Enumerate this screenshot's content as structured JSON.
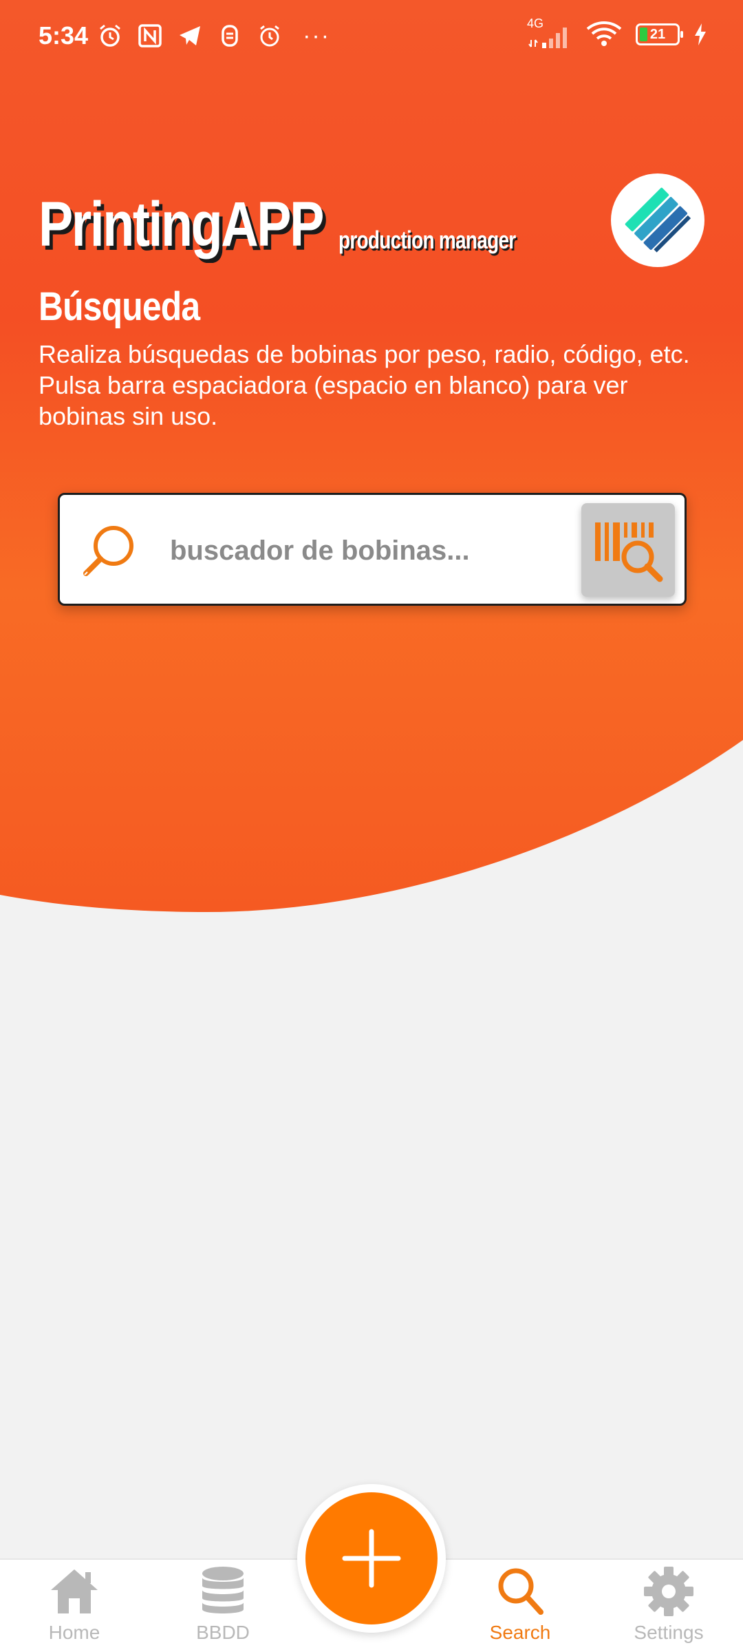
{
  "status_bar": {
    "time": "5:34",
    "network": "4G",
    "battery": "21",
    "more": "···"
  },
  "header": {
    "app_name": "PrintingAPP",
    "app_tagline": "production manager"
  },
  "page": {
    "title": "Búsqueda",
    "description": "Realiza búsquedas de bobinas por peso, radio, código, etc. Pulsa barra espaciadora (espacio en blanco) para ver bobinas sin uso."
  },
  "search": {
    "placeholder": "buscador de bobinas...",
    "value": ""
  },
  "bottom_nav": {
    "items": [
      {
        "label": "Home",
        "icon": "home-icon",
        "active": false
      },
      {
        "label": "BBDD",
        "icon": "database-icon",
        "active": false
      },
      {
        "label": "Search",
        "icon": "search-icon",
        "active": true
      },
      {
        "label": "Settings",
        "icon": "gear-icon",
        "active": false
      }
    ],
    "fab_icon": "plus-icon"
  },
  "colors": {
    "accent": "#ff7a00",
    "hero_top": "#f4582a",
    "hero_bottom": "#f76a24",
    "background": "#f2f2f2",
    "inactive": "#b8b8b8"
  }
}
